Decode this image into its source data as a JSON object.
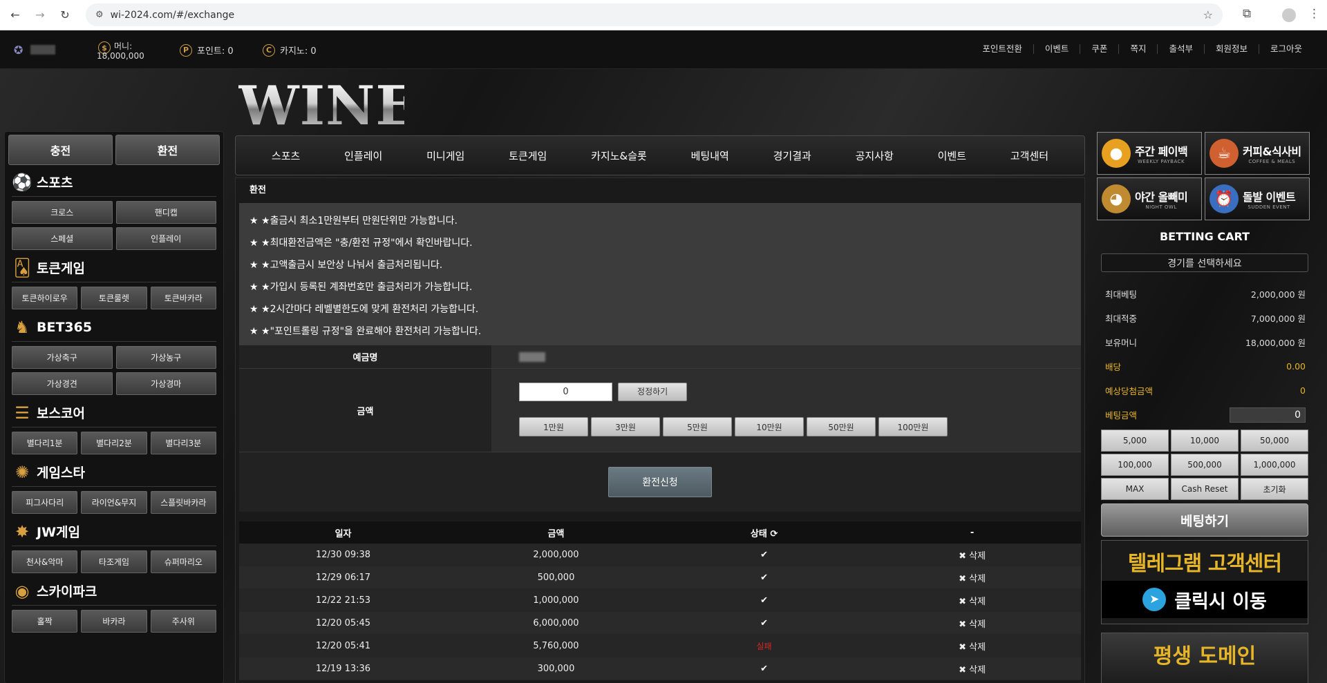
{
  "browser": {
    "url": "wi-2024.com/#/exchange"
  },
  "topbar": {
    "money_label": "머니:",
    "money_value": "18,000,000",
    "point_label": "포인트: 0",
    "casino_label": "카지노: 0",
    "nav": [
      "포인트전환",
      "이벤트",
      "쿠폰",
      "쪽지",
      "출석부",
      "회원정보",
      "로그아웃"
    ]
  },
  "logo": {
    "text": "WINE"
  },
  "sidebar": {
    "deposit": "충전",
    "withdraw": "환전",
    "categories": [
      {
        "title": "스포츠",
        "icon": "sports-icon",
        "buttons": [
          "크로스",
          "핸디캡",
          "스페셜",
          "인플레이"
        ],
        "cols": 2
      },
      {
        "title": "토큰게임",
        "icon": "cards-icon",
        "buttons": [
          "토큰하이로우",
          "토큰룰렛",
          "토큰바카라"
        ],
        "cols": 3
      },
      {
        "title": "BET365",
        "icon": "horse-icon",
        "buttons": [
          "가상축구",
          "가상농구",
          "가상경견",
          "가상경마"
        ],
        "cols": 2
      },
      {
        "title": "보스코어",
        "icon": "ladder-icon",
        "buttons": [
          "별다리1분",
          "별다리2분",
          "별다리3분"
        ],
        "cols": 3
      },
      {
        "title": "게임스타",
        "icon": "wheel-icon",
        "buttons": [
          "피그사다리",
          "라이언&무지",
          "스플릿바카라"
        ],
        "cols": 3
      },
      {
        "title": "JW게임",
        "icon": "star-icon",
        "buttons": [
          "천사&악마",
          "타조게임",
          "슈퍼마리오"
        ],
        "cols": 3
      },
      {
        "title": "스카이파크",
        "icon": "ufo-icon",
        "buttons": [
          "홀짝",
          "바카라",
          "주사위"
        ],
        "cols": 3
      }
    ]
  },
  "mainnav": [
    "스포츠",
    "인플레이",
    "미니게임",
    "토큰게임",
    "카지노&슬롯",
    "베팅내역",
    "경기결과",
    "공지사항",
    "이벤트",
    "고객센터"
  ],
  "exchange": {
    "title": "환전",
    "notices": [
      "★출금시 최소1만원부터 만원단위만 가능합니다.",
      "★최대환전금액은 \"충/환전 규정\"에서 확인바랍니다.",
      "★고액출금시 보안상 나눠서 출금처리됩니다.",
      "★가입시 등록된 계좌번호만 출금처리가 가능합니다.",
      "★2시간마다 레벨별한도에 맞게 환전처리 가능합니다.",
      "★\"포인트롤링 규정\"을 완료해야 환전처리 가능합니다."
    ],
    "account_label": "예금명",
    "amount_label": "금액",
    "amount_value": "0",
    "reset_label": "정정하기",
    "quick_amounts": [
      "1만원",
      "3만원",
      "5만원",
      "10만원",
      "50만원",
      "100만원"
    ],
    "submit_label": "환전신청"
  },
  "history": {
    "headers": [
      "일자",
      "금액",
      "상태",
      "-"
    ],
    "rows": [
      {
        "date": "12/30 09:38",
        "amount": "2,000,000",
        "status": "✔",
        "action": "✖ 삭제"
      },
      {
        "date": "12/29 06:17",
        "amount": "500,000",
        "status": "✔",
        "action": "✖ 삭제"
      },
      {
        "date": "12/22 21:53",
        "amount": "1,000,000",
        "status": "✔",
        "action": "✖ 삭제"
      },
      {
        "date": "12/20 05:45",
        "amount": "6,000,000",
        "status": "✔",
        "action": "✖ 삭제"
      },
      {
        "date": "12/20 05:41",
        "amount": "5,760,000",
        "status": "실패",
        "action": "✖ 삭제"
      },
      {
        "date": "12/19 13:36",
        "amount": "300,000",
        "status": "✔",
        "action": "✖ 삭제"
      }
    ]
  },
  "promos": [
    {
      "title": "주간 페이백",
      "sub": "WEEKLY PAYBACK",
      "icon": "coin-icon",
      "color": "#e7a020"
    },
    {
      "title": "커피&식사비",
      "sub": "COFFEE & MEALS",
      "icon": "coffee-icon",
      "color": "#d06030"
    },
    {
      "title": "야간 올빼미",
      "sub": "NIGHT OWL",
      "icon": "owl-icon",
      "color": "#c08a30"
    },
    {
      "title": "돌발 이벤트",
      "sub": "SUDDEN EVENT",
      "icon": "alarm-clock-icon",
      "color": "#3a6ec0"
    }
  ],
  "cart": {
    "title": "BETTING CART",
    "select_placeholder": "경기를 선택하세요",
    "rows": [
      {
        "label": "최대베팅",
        "value": "2,000,000 원",
        "gold": false
      },
      {
        "label": "최대적중",
        "value": "7,000,000 원",
        "gold": false
      },
      {
        "label": "보유머니",
        "value": "18,000,000 원",
        "gold": false
      },
      {
        "label": "배당",
        "value": "0.00",
        "gold": true
      },
      {
        "label": "예상당첨금액",
        "value": "0",
        "gold": true
      }
    ],
    "bet_amount_label": "베팅금액",
    "bet_amount_value": "0",
    "chips": [
      "5,000",
      "10,000",
      "50,000",
      "100,000",
      "500,000",
      "1,000,000",
      "MAX",
      "Cash Reset",
      "초기화"
    ],
    "bet_button": "베팅하기"
  },
  "telegram": {
    "line1": "텔레그램 고객센터",
    "line2": "클릭시 이동"
  },
  "domain_banner": {
    "text": "평생 도메인"
  }
}
